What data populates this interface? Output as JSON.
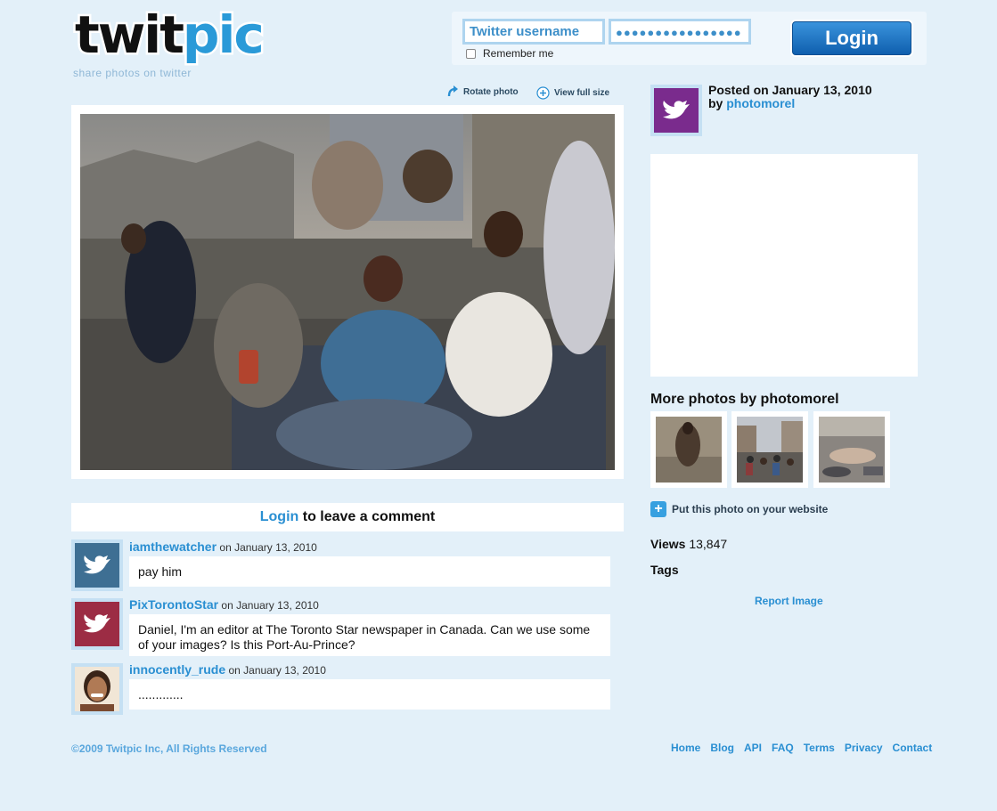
{
  "logo": {
    "word_dark": "twit",
    "word_blue": "pic",
    "tagline": "share photos on twitter"
  },
  "login": {
    "username_placeholder": "Twitter username",
    "password_value": "●●●●●●●●●●●●●●●●",
    "remember_label": "Remember me",
    "login_button": "Login"
  },
  "photo_tools": {
    "rotate": "Rotate photo",
    "view_full": "View full size"
  },
  "post": {
    "posted_on": "Posted on January 13, 2010",
    "by_label": "by",
    "author": "photomorel"
  },
  "comments_header": {
    "login_link": "Login",
    "rest": " to leave a comment"
  },
  "comments": [
    {
      "user": "iamthewatcher",
      "date": "on January 13, 2010",
      "text": "pay him",
      "avatar_color": "#3e6f93"
    },
    {
      "user": "PixTorontoStar",
      "date": "on January 13, 2010",
      "text": "Daniel, I'm an editor at The Toronto Star newspaper in Canada. Can we use some of your images? Is this Port-Au-Prince?",
      "avatar_color": "#9c2c44"
    },
    {
      "user": "innocently_rude",
      "date": "on January 13, 2010",
      "text": ".............",
      "avatar_color": "#caa184"
    }
  ],
  "more_photos": {
    "title": "More photos by photomorel"
  },
  "share": {
    "put_on_site": "Put this photo on your website"
  },
  "stats": {
    "views_label": "Views",
    "views_value": "13,847",
    "tags_label": "Tags"
  },
  "report": "Report Image",
  "footer": {
    "copyright": "©2009 Twitpic Inc, All Rights Reserved",
    "links": [
      "Home",
      "Blog",
      "API",
      "FAQ",
      "Terms",
      "Privacy",
      "Contact"
    ]
  },
  "colors": {
    "background": "#e3f0f9",
    "link": "#2a8fd2",
    "brand_blue": "#2a9ad8"
  }
}
